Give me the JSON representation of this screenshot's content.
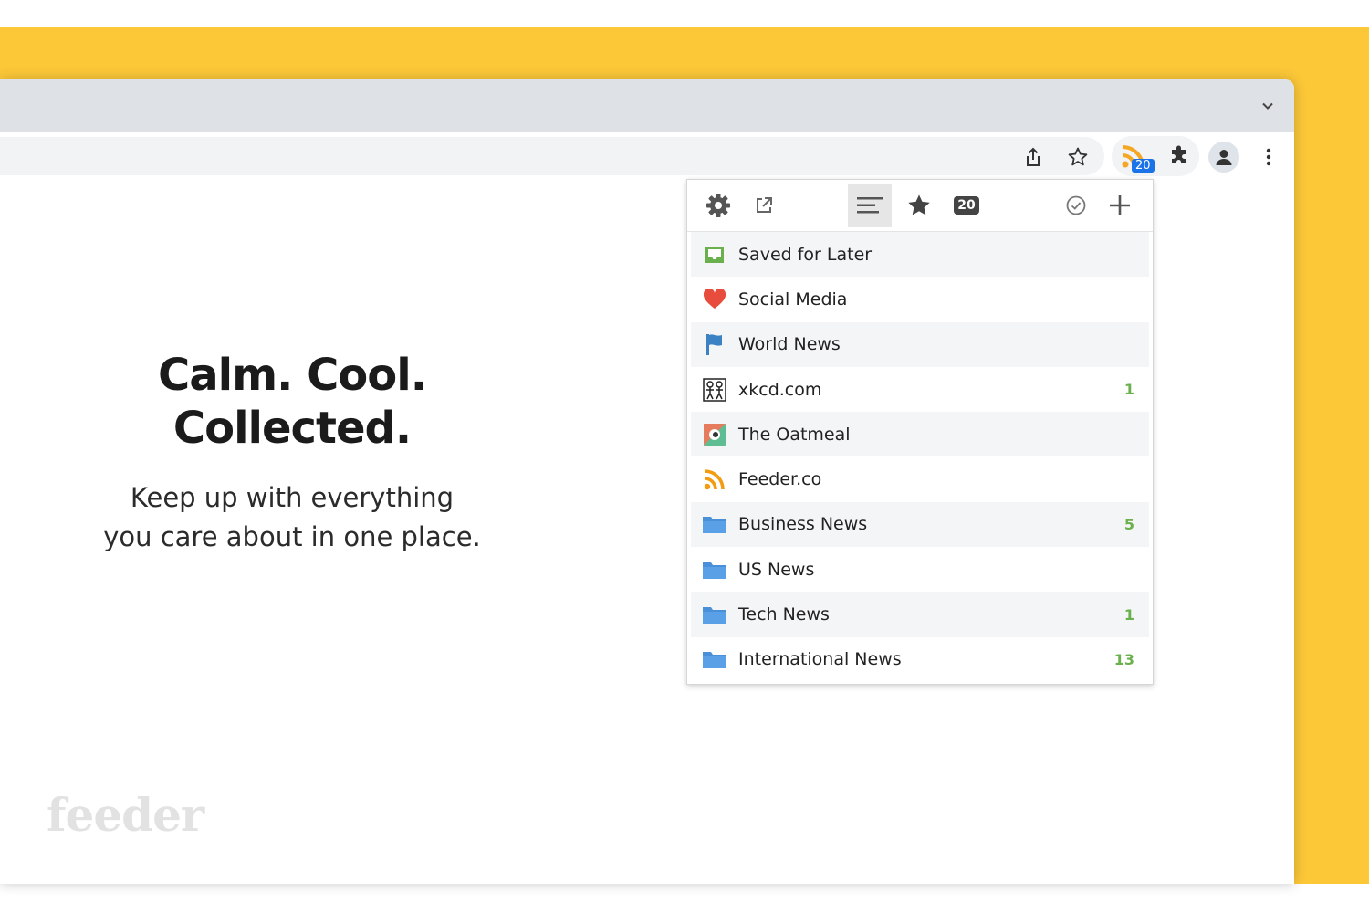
{
  "browser": {
    "extension_badge": "20"
  },
  "hero": {
    "title_line1": "Calm. Cool.",
    "title_line2": "Collected.",
    "subtitle_line1": "Keep up with everything",
    "subtitle_line2": "you care about in one place."
  },
  "brand": {
    "logo_text": "feeder"
  },
  "popup": {
    "toolbar": {
      "settings_icon": "gear-icon",
      "open_icon": "external-link-icon",
      "list_icon": "list-view-icon",
      "starred_icon": "star-icon",
      "unread_count": "20",
      "mark_read_icon": "check-circle-icon",
      "add_icon": "plus-icon"
    },
    "feeds": [
      {
        "label": "Saved for Later",
        "icon": "inbox-icon",
        "count": ""
      },
      {
        "label": "Social Media",
        "icon": "heart-icon",
        "count": ""
      },
      {
        "label": "World News",
        "icon": "flag-icon",
        "count": ""
      },
      {
        "label": "xkcd.com",
        "icon": "xkcd-favicon-icon",
        "count": "1"
      },
      {
        "label": "The Oatmeal",
        "icon": "oatmeal-favicon-icon",
        "count": ""
      },
      {
        "label": "Feeder.co",
        "icon": "rss-icon",
        "count": ""
      },
      {
        "label": "Business News",
        "icon": "folder-icon",
        "count": "5"
      },
      {
        "label": "US News",
        "icon": "folder-icon",
        "count": ""
      },
      {
        "label": "Tech News",
        "icon": "folder-icon",
        "count": "1"
      },
      {
        "label": "International News",
        "icon": "folder-icon",
        "count": "13"
      }
    ]
  },
  "colors": {
    "background_yellow": "#fcc838",
    "count_green": "#6ab04c",
    "folder_blue": "#4a90d9",
    "heart_red": "#e74c3c",
    "rss_orange": "#f39c12"
  }
}
